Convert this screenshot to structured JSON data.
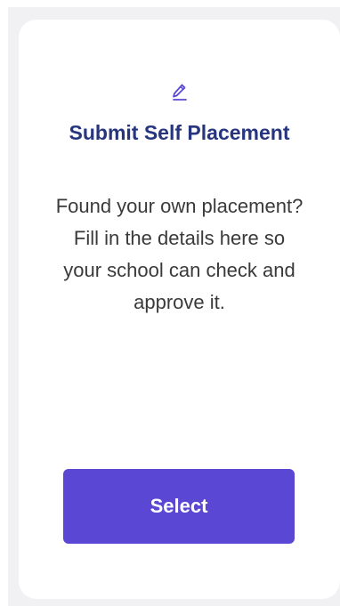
{
  "card": {
    "icon": "pencil-icon",
    "title": "Submit Self Placement",
    "description": "Found your own placement? Fill in the details here so your school can check and approve it.",
    "button_label": "Select"
  },
  "colors": {
    "accent": "#5a48d4",
    "title": "#26357d",
    "text": "#3a3a3a",
    "background": "#f1f1f4",
    "card": "#ffffff"
  }
}
